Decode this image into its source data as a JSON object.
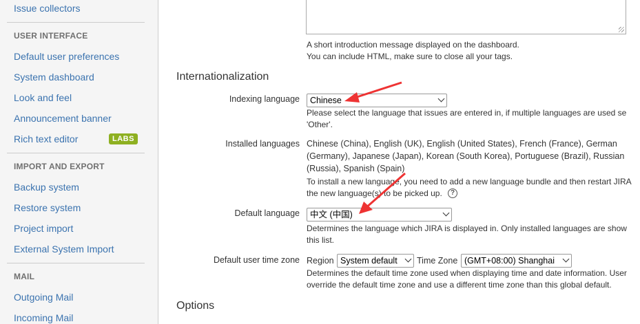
{
  "sidebar": {
    "top_link": "Issue collectors",
    "sections": [
      {
        "heading": "USER INTERFACE",
        "items": [
          "Default user preferences",
          "System dashboard",
          "Look and feel",
          "Announcement banner",
          "Rich text editor"
        ]
      },
      {
        "heading": "IMPORT AND EXPORT",
        "items": [
          "Backup system",
          "Restore system",
          "Project import",
          "External System Import"
        ]
      },
      {
        "heading": "MAIL",
        "items": [
          "Outgoing Mail",
          "Incoming Mail"
        ]
      }
    ],
    "labs_badge": "LABS"
  },
  "intro": {
    "desc_line1": "A short introduction message displayed on the dashboard.",
    "desc_line2": "You can include HTML, make sure to close all your tags."
  },
  "i18n": {
    "title": "Internationalization",
    "indexing_label": "Indexing language",
    "indexing_value": "Chinese",
    "indexing_desc1": "Please select the language that issues are entered in, if multiple languages are used se",
    "indexing_desc2": "'Other'.",
    "installed_label": "Installed languages",
    "installed_line1": "Chinese (China), English (UK), English (United States), French (France), German",
    "installed_line2": "(Germany), Japanese (Japan), Korean (South Korea), Portuguese (Brazil), Russian",
    "installed_line3": "(Russia), Spanish (Spain)",
    "installed_desc1": "To install a new language, you need to add a new language bundle and then restart JIRA",
    "installed_desc2": "the new language(s) to be picked up.",
    "default_label": "Default language",
    "default_value": "中文 (中国)",
    "default_desc1": "Determines the language which JIRA is displayed in. Only installed languages are show",
    "default_desc2": "this list.",
    "tz_label": "Default user time zone",
    "region_label": "Region",
    "region_value": "System default",
    "tz_inline_label": "Time Zone",
    "tz_value": "(GMT+08:00) Shanghai",
    "tz_desc1": "Determines the default time zone used when displaying time and date information. User",
    "tz_desc2": "override the default time zone and use a different time zone than this global default."
  },
  "options": {
    "title": "Options"
  },
  "icons": {
    "help": "help-icon",
    "select_arrow": "chevron-down-icon"
  },
  "colors": {
    "link": "#3b73af",
    "lozenge": "#8eb021",
    "annotation_arrow": "#ee3333"
  },
  "help_glyph": "?"
}
